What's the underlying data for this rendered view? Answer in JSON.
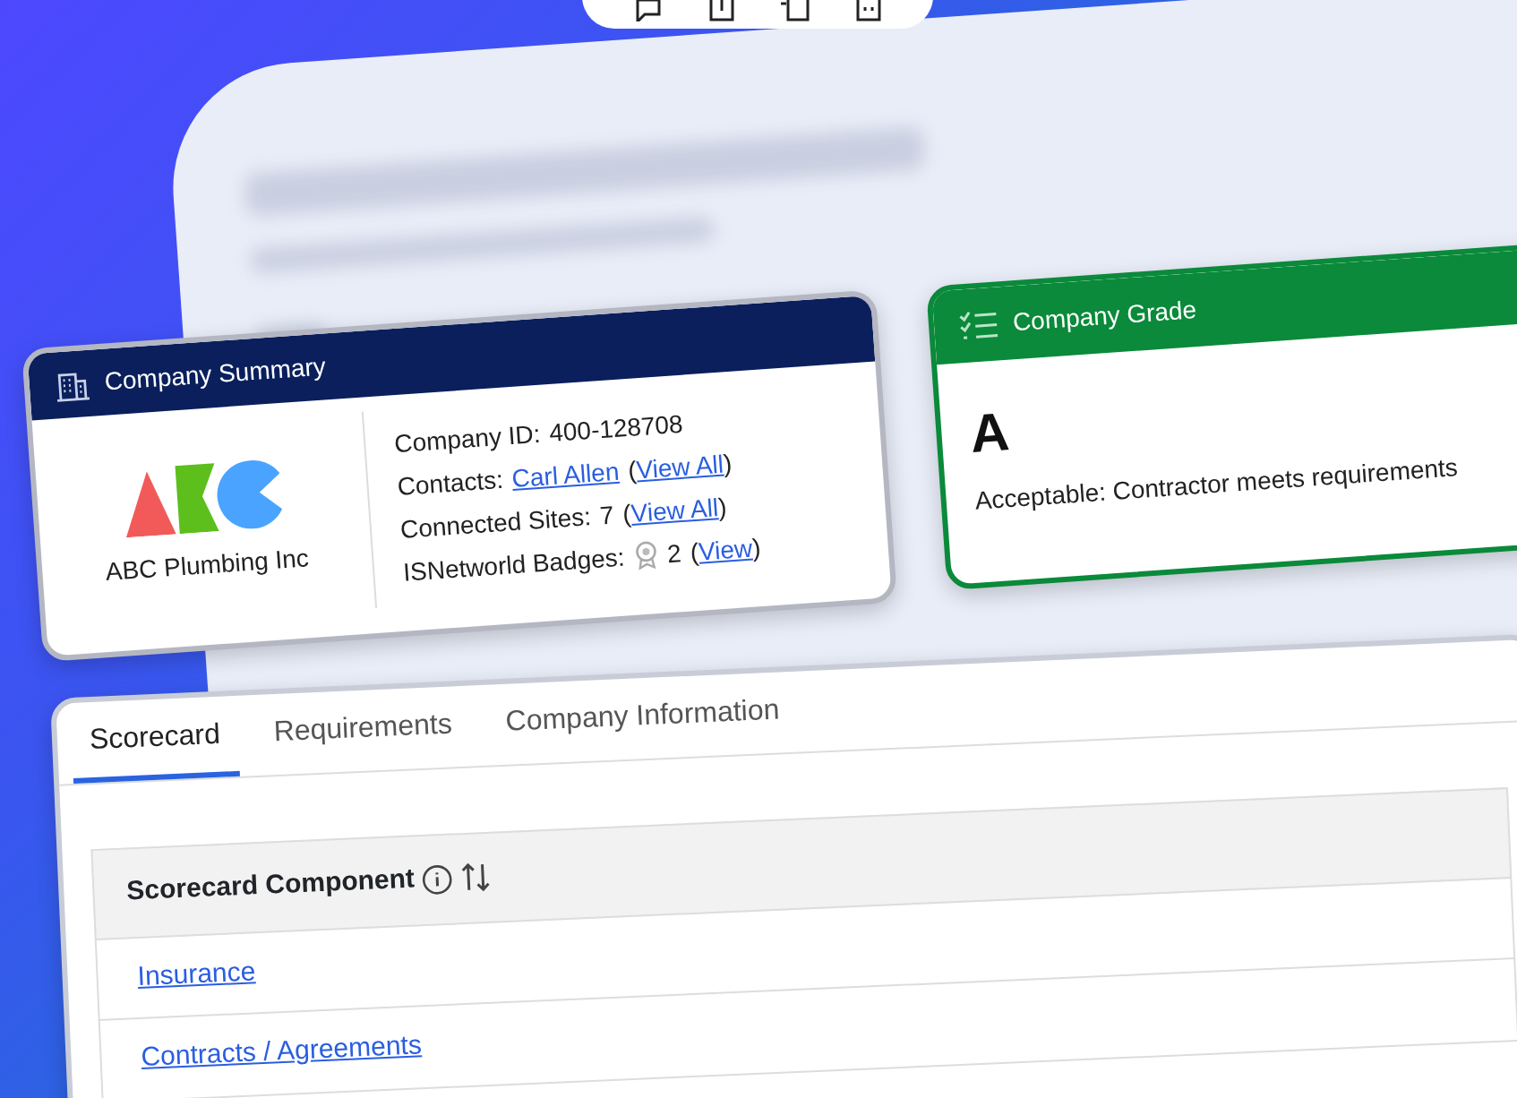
{
  "company_summary": {
    "title": "Company Summary",
    "company_name": "ABC Plumbing Inc",
    "fields": [
      {
        "kind": "text",
        "label": "Company ID:",
        "value": "400-128708"
      },
      {
        "kind": "link",
        "label": "Contacts:",
        "link": "Carl Allen",
        "open": "(",
        "paren_link": "View All",
        "close": ")"
      },
      {
        "kind": "count",
        "label": "Connected Sites:",
        "value": "7",
        "open": "(",
        "paren_link": "View All",
        "close": ")"
      },
      {
        "kind": "badge",
        "label": "ISNetworld Badges:",
        "value": "2",
        "open": "(",
        "paren_link": "View",
        "close": ")"
      }
    ]
  },
  "company_grade": {
    "title": "Company Grade",
    "grade": "A",
    "description": "Acceptable: Contractor meets requirements"
  },
  "tabs": [
    {
      "label": "Scorecard",
      "selected": true
    },
    {
      "label": "Requirements",
      "selected": false
    },
    {
      "label": "Company Information",
      "selected": false
    }
  ],
  "table": {
    "header": "Scorecard Component",
    "rows": [
      "Insurance",
      "Contracts / Agreements"
    ]
  }
}
